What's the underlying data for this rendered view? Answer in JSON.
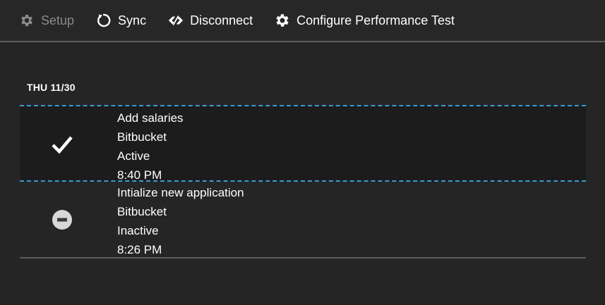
{
  "toolbar": {
    "setup": {
      "label": "Setup",
      "icon": "gear-icon",
      "enabled": false
    },
    "sync": {
      "label": "Sync",
      "icon": "sync-icon"
    },
    "disconnect": {
      "label": "Disconnect",
      "icon": "disconnect-icon"
    },
    "configure": {
      "label": "Configure Performance Test",
      "icon": "gear-icon"
    }
  },
  "date_header": "THU 11/30",
  "items": [
    {
      "name": "Add salaries",
      "source": "Bitbucket",
      "status": "Active",
      "time": "8:40 PM",
      "status_icon": "checkmark-icon",
      "selected": true
    },
    {
      "name": "Intialize new application",
      "source": "Bitbucket",
      "status": "Inactive",
      "time": "8:26 PM",
      "status_icon": "minus-circle-icon",
      "selected": false
    }
  ],
  "colors": {
    "background": "#252525",
    "selected_row": "#1c1c1c",
    "accent_dashed": "#3a9bd5",
    "disabled_text": "#8a8a8a"
  }
}
